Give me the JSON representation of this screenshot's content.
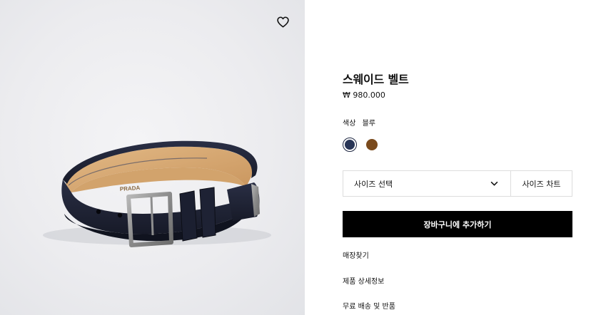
{
  "product": {
    "title": "스웨이드 벨트",
    "price": "₩ 980.000",
    "color_label": "색상",
    "color_value": "블루",
    "swatches": [
      {
        "name": "navy",
        "hex": "#283556",
        "selected": true
      },
      {
        "name": "brown",
        "hex": "#7a4a1c",
        "selected": false
      }
    ]
  },
  "size": {
    "select_label": "사이즈 선택",
    "chart_label": "사이즈 차트"
  },
  "cart": {
    "add_label": "장바구니에 추가하기"
  },
  "links": {
    "store_finder": "매장찾기",
    "product_details": "제품 상세정보",
    "shipping_returns": "무료 배송 및 반품"
  },
  "image": {
    "wishlist_icon": "heart-outline-icon",
    "belt_brand_text": "PRADA"
  },
  "colors": {
    "accent": "#000000",
    "border": "#dddddd",
    "image_bg": "#ececef"
  }
}
